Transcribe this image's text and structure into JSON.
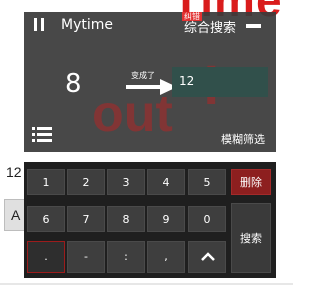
{
  "background": {
    "title_text": "Time",
    "value_text": "12",
    "button_label": "A"
  },
  "panel": {
    "app_title": "Mytime",
    "badge_label": "纠错",
    "search_mode_label": "综合搜索",
    "number_from": "8",
    "became_label": "变成了",
    "number_to": "12",
    "fuzzy_filter_label": "模糊筛选",
    "ghost_out": "out",
    "ghost_bang": "!"
  },
  "keypad": {
    "row1": [
      "1",
      "2",
      "3",
      "4",
      "5"
    ],
    "delete_label": "删除",
    "row2": [
      "6",
      "7",
      "8",
      "9",
      "0"
    ],
    "row3": [
      ".",
      "-",
      ":",
      ","
    ],
    "search_label": "搜索"
  },
  "colors": {
    "accent_red": "#d91c1c",
    "panel_bg": "#3a3a3a",
    "result_box": "#31504b",
    "delete_key": "#8d1f1f"
  },
  "icons": [
    "pause-icon",
    "minimize-icon",
    "arrow-icon",
    "list-icon",
    "chevron-up-icon"
  ]
}
